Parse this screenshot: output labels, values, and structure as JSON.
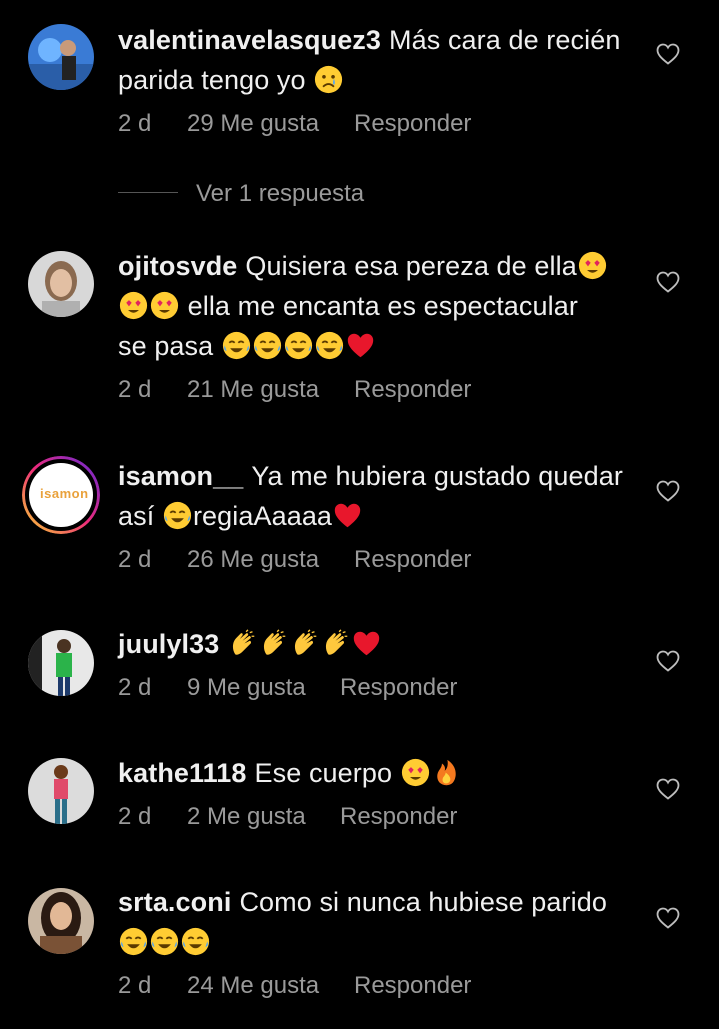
{
  "comments": [
    {
      "username": "valentinavelasquez3",
      "text": "Más cara de recién parida tengo yo",
      "emojis": [
        "crying-face"
      ],
      "time": "2 d",
      "likes": "29 Me gusta",
      "reply": "Responder",
      "replies_label": "Ver 1 respuesta"
    },
    {
      "username": "ojitosvde",
      "text_lines": [
        "Quisiera esa pereza de ella",
        "ella me encanta es espectacular",
        "se pasa"
      ],
      "emojis": [
        "heart-eyes",
        "heart-eyes",
        "heart-eyes",
        "joy",
        "joy",
        "joy",
        "joy",
        "red-heart"
      ],
      "time": "2 d",
      "likes": "21 Me gusta",
      "reply": "Responder"
    },
    {
      "username": "isamon__",
      "text_a": "Ya me hubiera gustado quedar",
      "text_b": "así",
      "text_c": "regiaAaaaa",
      "emojis": [
        "joy",
        "red-heart"
      ],
      "avatar_label": "isamon",
      "time": "2 d",
      "likes": "26 Me gusta",
      "reply": "Responder"
    },
    {
      "username": "juulyl33",
      "emojis": [
        "clapping-hands",
        "clapping-hands",
        "clapping-hands",
        "clapping-hands",
        "red-heart"
      ],
      "time": "2 d",
      "likes": "9 Me gusta",
      "reply": "Responder"
    },
    {
      "username": "kathe1118",
      "text": "Ese cuerpo",
      "emojis": [
        "heart-eyes",
        "fire"
      ],
      "time": "2 d",
      "likes": "2 Me gusta",
      "reply": "Responder"
    },
    {
      "username": "srta.coni",
      "text": "Como si nunca hubiese parido",
      "emojis": [
        "joy",
        "joy",
        "joy"
      ],
      "time": "2 d",
      "likes": "24 Me gusta",
      "reply": "Responder"
    }
  ],
  "colors": {
    "background": "#000000",
    "text": "#f0f0f0",
    "meta": "#9a9a9a",
    "story_ring": "#d62976"
  }
}
